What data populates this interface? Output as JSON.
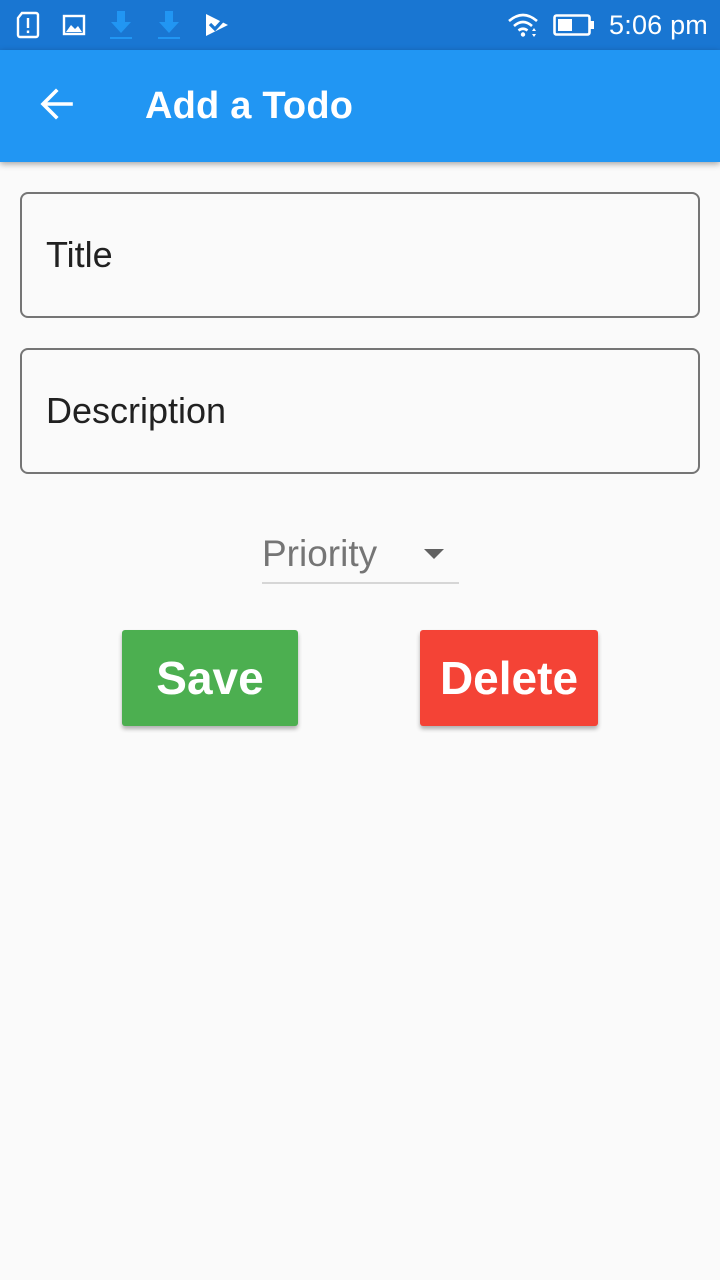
{
  "status_bar": {
    "time": "5:06 pm",
    "icons": [
      "sim-alert-icon",
      "image-icon",
      "download-icon",
      "download-icon",
      "app-check-icon",
      "wifi-icon",
      "battery-icon"
    ]
  },
  "app_bar": {
    "title": "Add a Todo",
    "back_icon": "arrow-back-icon"
  },
  "form": {
    "title_placeholder": "Title",
    "title_value": "",
    "description_placeholder": "Description",
    "description_value": "",
    "priority_label": "Priority"
  },
  "actions": {
    "save_label": "Save",
    "delete_label": "Delete"
  },
  "colors": {
    "status_bar": "#1976d2",
    "app_bar": "#2196f3",
    "save": "#4caf50",
    "delete": "#f44336",
    "background": "#fafafa"
  }
}
